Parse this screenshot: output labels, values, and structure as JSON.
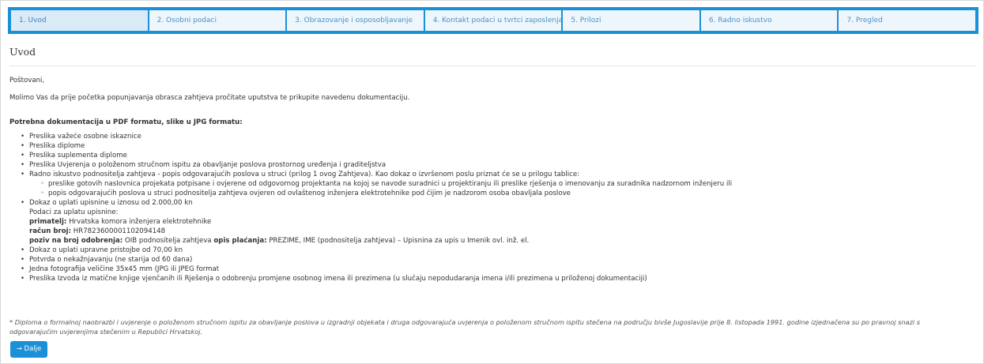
{
  "steps": [
    {
      "label": "1. Uvod",
      "active": true
    },
    {
      "label": "2. Osobni podaci",
      "active": false
    },
    {
      "label": "3. Obrazovanje i osposobljavanje",
      "active": false
    },
    {
      "label": "4. Kontakt podaci u tvrtci zaposlenja",
      "active": false
    },
    {
      "label": "5. Prilozi",
      "active": false
    },
    {
      "label": "6. Radno iskustvo",
      "active": false
    },
    {
      "label": "7. Pregled",
      "active": false
    }
  ],
  "section_title": "Uvod",
  "greeting": "Poštovani,",
  "intro": "Molimo Vas da prije početka popunjavanja obrasca zahtjeva pročitate uputstva te prikupite navedenu dokumentaciju.",
  "docs_heading": "Potrebna dokumentacija u PDF formatu, slike u JPG formatu:",
  "docs": {
    "item1": "Preslika važeće osobne iskaznice",
    "item2": "Preslika diplome",
    "item3": "Preslika suplementa diplome",
    "item4": "Preslika Uvjerenja o položenom stručnom ispitu za obavljanje poslova prostornog uređenja i graditeljstva",
    "item5": "Radno iskustvo podnositelja zahtjeva - popis odgovarajućih poslova u struci (prilog 1 ovog Zahtjeva). Kao dokaz o izvršenom poslu priznat će se u prilogu tablice:",
    "item5_sub1": "preslike gotovih naslovnica projekata potpisane i ovjerene od odgovornog projektanta na kojoj se navode suradnici u projektiranju ili preslike rješenja o imenovanju za suradnika nadzornom inženjeru ili",
    "item5_sub2": "popis odgovarajućih poslova u struci podnositelja zahtjeva ovjeren od ovlaštenog inženjera elektrotehnike pod čijim je nadzorom osoba obavljala poslove",
    "item6": "Dokaz o uplati upisnine u iznosu od 2.000,00 kn",
    "payment_heading": "Podaci za uplatu upisnine:",
    "recipient_label": "primatelj:",
    "recipient_value": "Hrvatska komora inženjera elektrotehnike",
    "account_label": "račun broj:",
    "account_value": "HR7823600001102094148",
    "reference_label": "poziv na broj odobrenja:",
    "reference_value": "OIB podnositelja zahtjeva",
    "description_label": "opis plaćanja:",
    "description_value": "PREZIME, IME (podnositelja zahtjeva) – Upisnina za upis u Imenik ovl. inž. el.",
    "item7": "Dokaz o uplati upravne pristojbe od 70,00 kn",
    "item8": "Potvrda o nekažnjavanju (ne starija od 60 dana)",
    "item9": "Jedna fotografija veličine 35x45 mm (JPG ili JPEG format",
    "item10": "Preslika Izvoda iz matične knjige vjenčanih ili Rješenja o odobrenju promjene osobnog imena ili prezimena (u slučaju nepodudaranja imena i/ili prezimena u priloženoj dokumentaciji)"
  },
  "footnote": "* Diploma o formalnoj naobrazbi i uvjerenje o položenom stručnom ispitu za obavljanje poslova u izgradnji objekata i druga odgovarajuća uvjerenja o položenom stručnom ispitu stečena na području bivše Jugoslavije prije 8. listopada 1991. godine izjednačena su po pravnoj snazi s odgovarajućim uvjerenjima stečenim u Republici Hrvatskoj.",
  "next_button": "→ Dalje",
  "colors": {
    "accent": "#1a90d8",
    "tab_bg": "#eef6fc",
    "tab_text": "#4a90c8"
  }
}
